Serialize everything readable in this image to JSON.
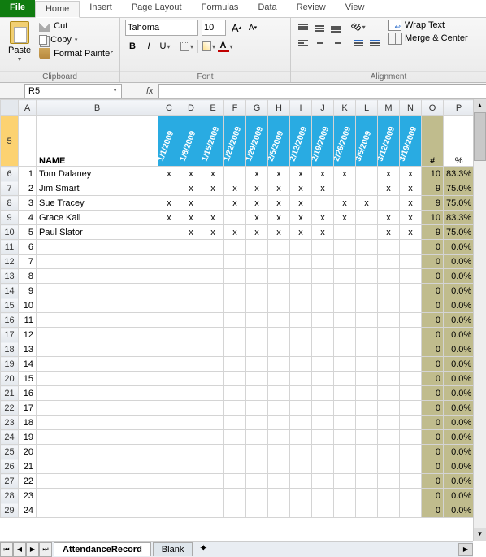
{
  "tabs": {
    "file": "File",
    "home": "Home",
    "insert": "Insert",
    "pagelayout": "Page Layout",
    "formulas": "Formulas",
    "data": "Data",
    "review": "Review",
    "view": "View"
  },
  "clipboard": {
    "paste": "Paste",
    "cut": "Cut",
    "copy": "Copy",
    "format_painter": "Format Painter",
    "label": "Clipboard"
  },
  "font": {
    "name": "Tahoma",
    "size": "10",
    "grow": "A",
    "shrink": "A",
    "bold": "B",
    "italic": "I",
    "underline": "U",
    "label": "Font"
  },
  "align": {
    "wrap": "Wrap Text",
    "merge": "Merge & Center",
    "label": "Alignment"
  },
  "namebox": "R5",
  "fx": "fx",
  "cols": [
    "A",
    "B",
    "C",
    "D",
    "E",
    "F",
    "G",
    "H",
    "I",
    "J",
    "K",
    "L",
    "M",
    "N",
    "O",
    "P"
  ],
  "widths": [
    22,
    150,
    27,
    27,
    27,
    27,
    27,
    27,
    27,
    27,
    27,
    27,
    27,
    27,
    27,
    36
  ],
  "header_row_number": "5",
  "name_header": "NAME",
  "dates": [
    "1/1/2009",
    "1/8/2009",
    "1/15/2009",
    "1/22/2009",
    "1/29/2009",
    "2/5/2009",
    "2/12/2009",
    "2/19/2009",
    "2/26/2009",
    "3/5/2009",
    "3/12/2009",
    "3/19/2009"
  ],
  "hash": "#",
  "pct": "%",
  "rows": [
    {
      "n": "6",
      "idx": "1",
      "name": "Tom Dalaney",
      "marks": [
        "x",
        "x",
        "x",
        "",
        "x",
        "x",
        "x",
        "x",
        "x",
        "",
        "x",
        "x"
      ],
      "count": "10",
      "pct": "83.3%"
    },
    {
      "n": "7",
      "idx": "2",
      "name": "Jim Smart",
      "marks": [
        "",
        "x",
        "x",
        "x",
        "x",
        "x",
        "x",
        "x",
        "",
        "",
        "x",
        "x"
      ],
      "count": "9",
      "pct": "75.0%"
    },
    {
      "n": "8",
      "idx": "3",
      "name": "Sue Tracey",
      "marks": [
        "x",
        "x",
        "",
        "x",
        "x",
        "x",
        "x",
        "",
        "x",
        "x",
        "",
        "x"
      ],
      "count": "9",
      "pct": "75.0%"
    },
    {
      "n": "9",
      "idx": "4",
      "name": "Grace Kali",
      "marks": [
        "x",
        "x",
        "x",
        "",
        "x",
        "x",
        "x",
        "x",
        "x",
        "",
        "x",
        "x"
      ],
      "count": "10",
      "pct": "83.3%"
    },
    {
      "n": "10",
      "idx": "5",
      "name": "Paul Slator",
      "marks": [
        "",
        "x",
        "x",
        "x",
        "x",
        "x",
        "x",
        "x",
        "",
        "",
        "x",
        "x"
      ],
      "count": "9",
      "pct": "75.0%"
    },
    {
      "n": "11",
      "idx": "6",
      "name": "",
      "marks": [
        "",
        "",
        "",
        "",
        "",
        "",
        "",
        "",
        "",
        "",
        "",
        ""
      ],
      "count": "0",
      "pct": "0.0%"
    },
    {
      "n": "12",
      "idx": "7",
      "name": "",
      "marks": [
        "",
        "",
        "",
        "",
        "",
        "",
        "",
        "",
        "",
        "",
        "",
        ""
      ],
      "count": "0",
      "pct": "0.0%"
    },
    {
      "n": "13",
      "idx": "8",
      "name": "",
      "marks": [
        "",
        "",
        "",
        "",
        "",
        "",
        "",
        "",
        "",
        "",
        "",
        ""
      ],
      "count": "0",
      "pct": "0.0%"
    },
    {
      "n": "14",
      "idx": "9",
      "name": "",
      "marks": [
        "",
        "",
        "",
        "",
        "",
        "",
        "",
        "",
        "",
        "",
        "",
        ""
      ],
      "count": "0",
      "pct": "0.0%"
    },
    {
      "n": "15",
      "idx": "10",
      "name": "",
      "marks": [
        "",
        "",
        "",
        "",
        "",
        "",
        "",
        "",
        "",
        "",
        "",
        ""
      ],
      "count": "0",
      "pct": "0.0%"
    },
    {
      "n": "16",
      "idx": "11",
      "name": "",
      "marks": [
        "",
        "",
        "",
        "",
        "",
        "",
        "",
        "",
        "",
        "",
        "",
        ""
      ],
      "count": "0",
      "pct": "0.0%"
    },
    {
      "n": "17",
      "idx": "12",
      "name": "",
      "marks": [
        "",
        "",
        "",
        "",
        "",
        "",
        "",
        "",
        "",
        "",
        "",
        ""
      ],
      "count": "0",
      "pct": "0.0%"
    },
    {
      "n": "18",
      "idx": "13",
      "name": "",
      "marks": [
        "",
        "",
        "",
        "",
        "",
        "",
        "",
        "",
        "",
        "",
        "",
        ""
      ],
      "count": "0",
      "pct": "0.0%"
    },
    {
      "n": "19",
      "idx": "14",
      "name": "",
      "marks": [
        "",
        "",
        "",
        "",
        "",
        "",
        "",
        "",
        "",
        "",
        "",
        ""
      ],
      "count": "0",
      "pct": "0.0%"
    },
    {
      "n": "20",
      "idx": "15",
      "name": "",
      "marks": [
        "",
        "",
        "",
        "",
        "",
        "",
        "",
        "",
        "",
        "",
        "",
        ""
      ],
      "count": "0",
      "pct": "0.0%"
    },
    {
      "n": "21",
      "idx": "16",
      "name": "",
      "marks": [
        "",
        "",
        "",
        "",
        "",
        "",
        "",
        "",
        "",
        "",
        "",
        ""
      ],
      "count": "0",
      "pct": "0.0%"
    },
    {
      "n": "22",
      "idx": "17",
      "name": "",
      "marks": [
        "",
        "",
        "",
        "",
        "",
        "",
        "",
        "",
        "",
        "",
        "",
        ""
      ],
      "count": "0",
      "pct": "0.0%"
    },
    {
      "n": "23",
      "idx": "18",
      "name": "",
      "marks": [
        "",
        "",
        "",
        "",
        "",
        "",
        "",
        "",
        "",
        "",
        "",
        ""
      ],
      "count": "0",
      "pct": "0.0%"
    },
    {
      "n": "24",
      "idx": "19",
      "name": "",
      "marks": [
        "",
        "",
        "",
        "",
        "",
        "",
        "",
        "",
        "",
        "",
        "",
        ""
      ],
      "count": "0",
      "pct": "0.0%"
    },
    {
      "n": "25",
      "idx": "20",
      "name": "",
      "marks": [
        "",
        "",
        "",
        "",
        "",
        "",
        "",
        "",
        "",
        "",
        "",
        ""
      ],
      "count": "0",
      "pct": "0.0%"
    },
    {
      "n": "26",
      "idx": "21",
      "name": "",
      "marks": [
        "",
        "",
        "",
        "",
        "",
        "",
        "",
        "",
        "",
        "",
        "",
        ""
      ],
      "count": "0",
      "pct": "0.0%"
    },
    {
      "n": "27",
      "idx": "22",
      "name": "",
      "marks": [
        "",
        "",
        "",
        "",
        "",
        "",
        "",
        "",
        "",
        "",
        "",
        ""
      ],
      "count": "0",
      "pct": "0.0%"
    },
    {
      "n": "28",
      "idx": "23",
      "name": "",
      "marks": [
        "",
        "",
        "",
        "",
        "",
        "",
        "",
        "",
        "",
        "",
        "",
        ""
      ],
      "count": "0",
      "pct": "0.0%"
    },
    {
      "n": "29",
      "idx": "24",
      "name": "",
      "marks": [
        "",
        "",
        "",
        "",
        "",
        "",
        "",
        "",
        "",
        "",
        "",
        ""
      ],
      "count": "0",
      "pct": "0.0%"
    }
  ],
  "sheets": {
    "active": "AttendanceRecord",
    "blank": "Blank"
  }
}
